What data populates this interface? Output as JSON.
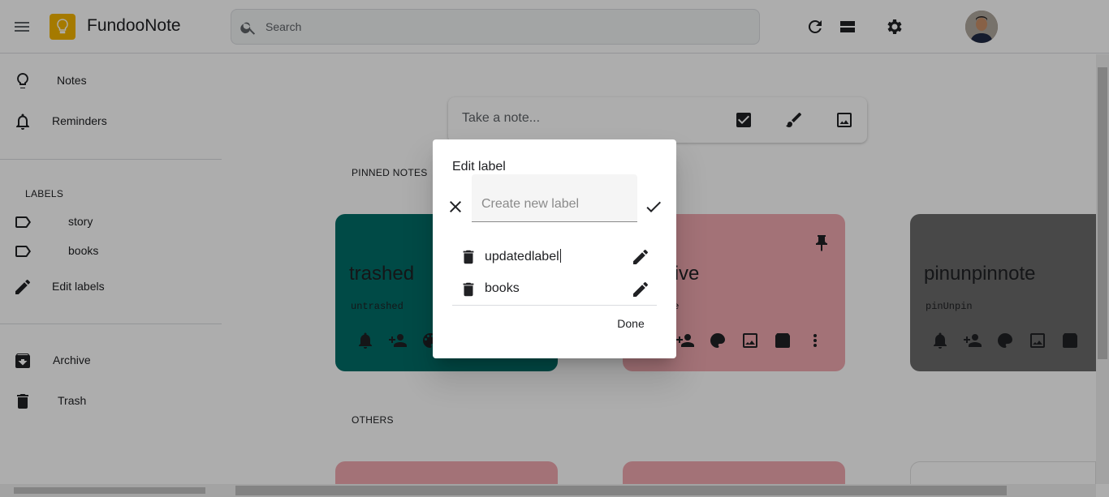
{
  "header": {
    "app_title": "FundooNote",
    "search_placeholder": "Search",
    "search_value": "",
    "icons": [
      "menu-icon",
      "bulb-logo-icon",
      "search-icon",
      "refresh-icon",
      "list-view-icon",
      "settings-icon"
    ]
  },
  "sidebar": {
    "items": [
      {
        "label": "Notes",
        "icon": "lightbulb-icon"
      },
      {
        "label": "Reminders",
        "icon": "bell-icon"
      }
    ],
    "labels_title": "LABELS",
    "labels": [
      {
        "label": "story",
        "icon": "label-outline-icon"
      },
      {
        "label": "books",
        "icon": "label-outline-icon"
      }
    ],
    "edit_labels": {
      "label": "Edit labels",
      "icon": "pencil-icon"
    },
    "bottom_items": [
      {
        "label": "Archive",
        "icon": "archive-icon"
      },
      {
        "label": "Trash",
        "icon": "trash-icon"
      }
    ]
  },
  "main": {
    "note_input_placeholder": "Take a note...",
    "pinned_title": "PINNED NOTES",
    "others_title": "OTHERS",
    "cards": [
      {
        "title": "trashed",
        "body": "untrashed",
        "color": "#006d67"
      },
      {
        "title": "archive",
        "body": "archive",
        "color": "#f0a8b0"
      },
      {
        "title": "pinunpinnote",
        "body": "pinUnpin",
        "color": "#6b6b6b"
      }
    ],
    "other_card_colors": [
      "#f0a8b0",
      "#f0a8b0",
      "#ffffff"
    ]
  },
  "dialog": {
    "title": "Edit label",
    "new_label_placeholder": "Create new label",
    "new_label_value": "",
    "labels": [
      {
        "text": "updatedlabel"
      },
      {
        "text": "books"
      }
    ],
    "done_label": "Done"
  },
  "colors": {
    "overlay": "rgba(0,0,0,0.32)",
    "teal": "#006d67",
    "pink": "#f0a8b0",
    "grey": "#6b6b6b",
    "logo": "#f4b400"
  }
}
